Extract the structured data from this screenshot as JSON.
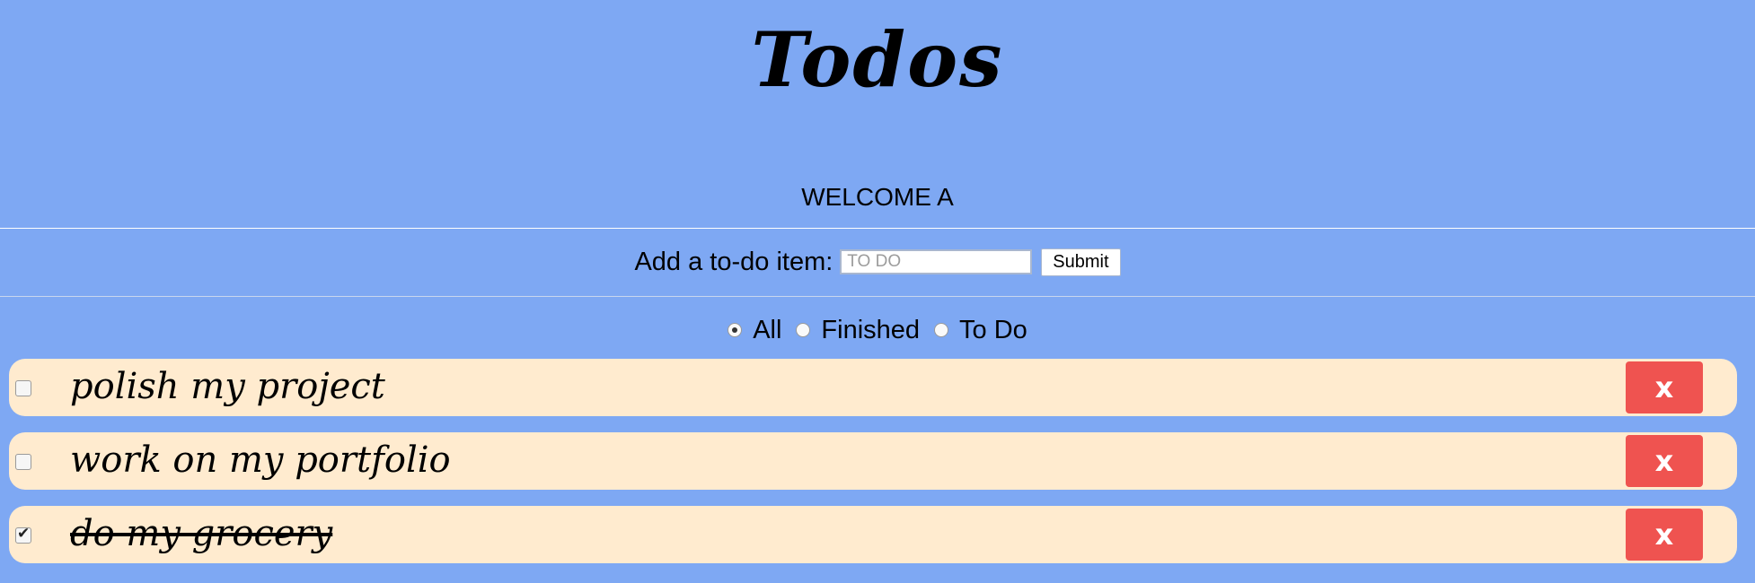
{
  "header": {
    "title": "Todos",
    "welcome": "WELCOME A"
  },
  "add_form": {
    "label": "Add a to-do item:",
    "input_placeholder": "TO DO",
    "input_value": "",
    "submit_label": "Submit"
  },
  "filters": {
    "selected": "All",
    "options": [
      {
        "label": "All",
        "checked": true
      },
      {
        "label": "Finished",
        "checked": false
      },
      {
        "label": "To Do",
        "checked": false
      }
    ]
  },
  "todos": [
    {
      "text": "polish my project",
      "done": false,
      "delete_label": "x"
    },
    {
      "text": "work on my portfolio",
      "done": false,
      "delete_label": "x"
    },
    {
      "text": "do my grocery",
      "done": true,
      "delete_label": "x"
    }
  ],
  "colors": {
    "background": "#7ea8f3",
    "item_background": "#ffebcf",
    "delete_button": "#ef5350"
  }
}
